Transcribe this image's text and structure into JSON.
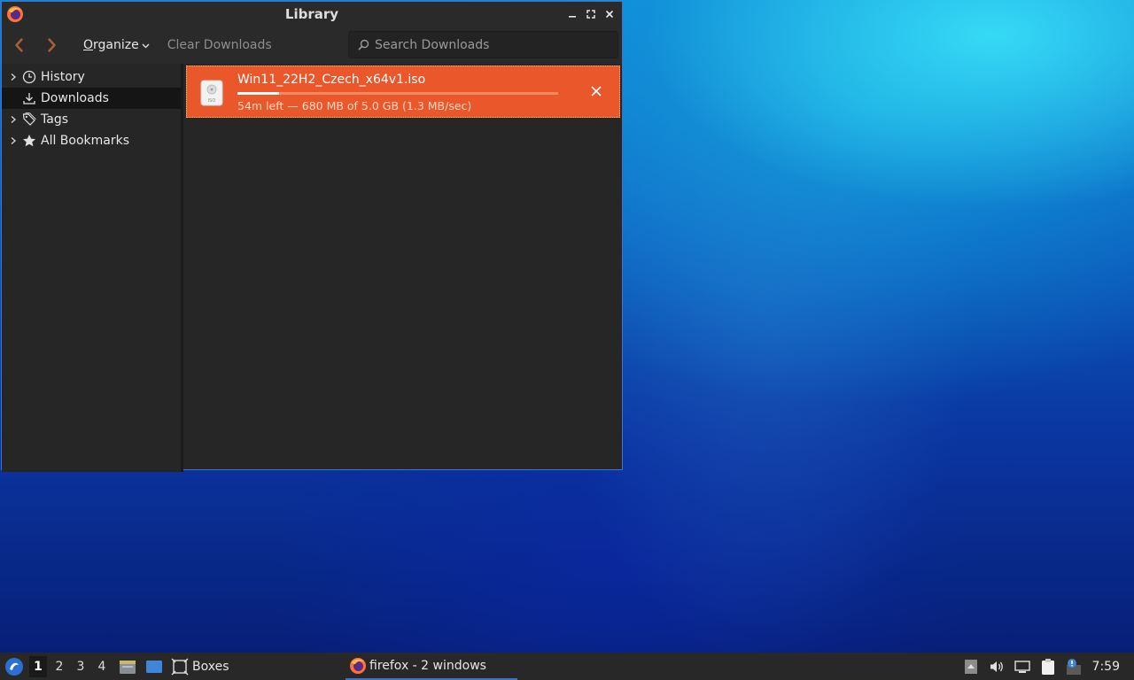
{
  "window": {
    "title": "Library"
  },
  "toolbar": {
    "organize_label": "Organize",
    "clear_downloads_label": "Clear Downloads",
    "search_placeholder": "Search Downloads"
  },
  "sidebar": {
    "items": [
      {
        "label": "History",
        "icon": "clock-icon",
        "expandable": true,
        "selected": false
      },
      {
        "label": "Downloads",
        "icon": "download-icon",
        "expandable": false,
        "selected": true
      },
      {
        "label": "Tags",
        "icon": "tag-icon",
        "expandable": true,
        "selected": false
      },
      {
        "label": "All Bookmarks",
        "icon": "star-icon",
        "expandable": true,
        "selected": false
      }
    ]
  },
  "downloads": [
    {
      "file_name": "Win11_22H2_Czech_x64v1.iso",
      "status": "54m left — 680 MB of 5.0 GB (1.3 MB/sec)",
      "progress_fraction": 0.13,
      "icon_label": "ISO"
    }
  ],
  "taskbar": {
    "desktops": [
      "1",
      "2",
      "3",
      "4"
    ],
    "active_desktop": "1",
    "boxes_label": "Boxes",
    "task_label": "firefox - 2 windows",
    "clock": "7:59"
  },
  "colors": {
    "download_highlight": "#e9572a",
    "window_border": "#3f73c8",
    "panel_bg": "#262626"
  }
}
